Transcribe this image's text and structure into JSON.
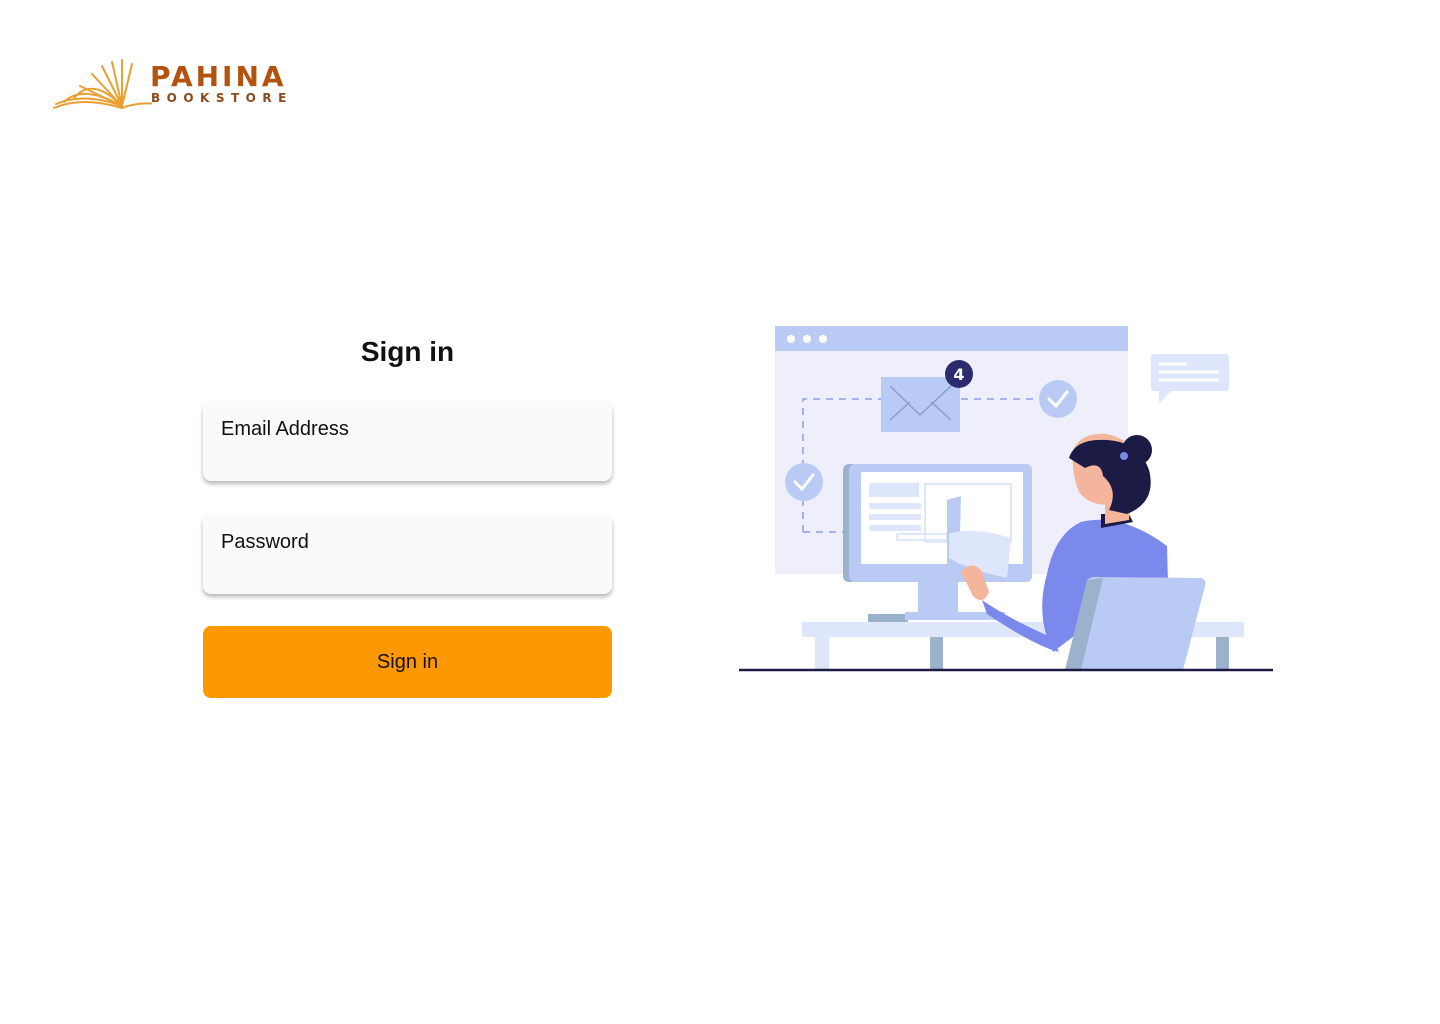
{
  "brand": {
    "name": "PAHINA",
    "tagline": "BOOKSTORE",
    "colors": {
      "name": "#b4520f",
      "tagline": "#8a4a1a",
      "book": "#e9a030"
    }
  },
  "form": {
    "title": "Sign in",
    "email": {
      "label": "Email Address",
      "value": "",
      "placeholder": ""
    },
    "password": {
      "label": "Password",
      "value": "",
      "placeholder": ""
    },
    "submit_label": "Sign in"
  },
  "illustration": {
    "subject": "woman at desk with computer and email",
    "notification_count": "4"
  },
  "colors": {
    "accent": "#fe9802",
    "illustration_primary": "#b9cbf4",
    "illustration_bg": "#efeffc",
    "illustration_dark": "#1b1b45",
    "illustration_shirt": "#7b89ec"
  }
}
